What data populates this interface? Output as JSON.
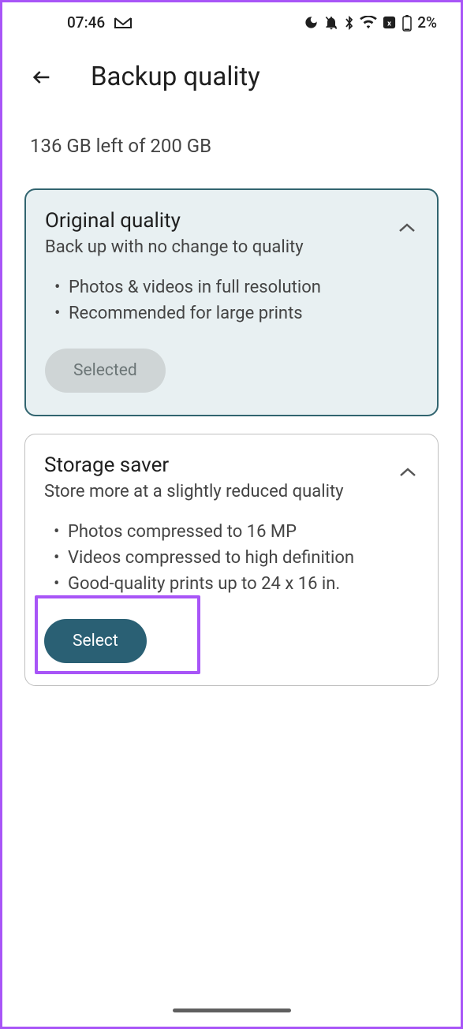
{
  "status_bar": {
    "time": "07:46",
    "battery_percent": "2%"
  },
  "header": {
    "title": "Backup quality"
  },
  "storage": {
    "text": "136 GB left of 200 GB"
  },
  "cards": {
    "original": {
      "title": "Original quality",
      "subtitle": "Back up with no change to quality",
      "bullets": [
        "Photos & videos in full resolution",
        "Recommended for large prints"
      ],
      "button_label": "Selected"
    },
    "saver": {
      "title": "Storage saver",
      "subtitle": "Store more at a slightly reduced quality",
      "bullets": [
        "Photos compressed to 16 MP",
        "Videos compressed to high definition",
        "Good-quality prints up to 24 x 16 in."
      ],
      "button_label": "Select"
    }
  }
}
